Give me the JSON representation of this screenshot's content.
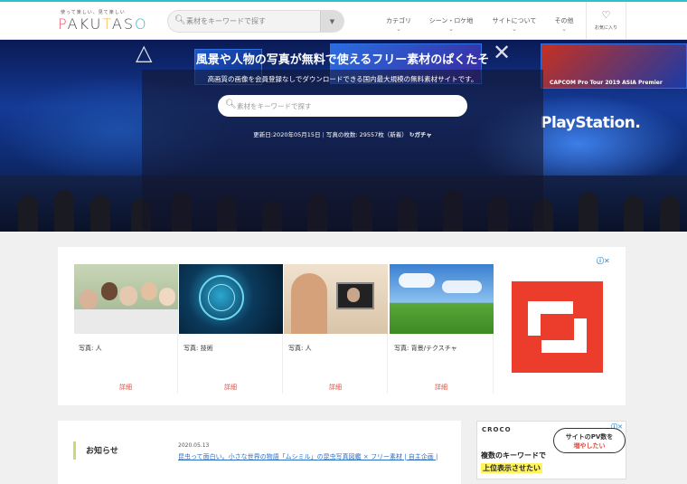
{
  "header": {
    "tagline": "使って楽しい、見て楽しい",
    "logo": "PAKUTASO",
    "search_placeholder": "素材をキーワードで探す",
    "nav": [
      {
        "label": "カテゴリ"
      },
      {
        "label": "シーン・ロケ地"
      },
      {
        "label": "サイトについて"
      },
      {
        "label": "その他"
      }
    ],
    "favorites_label": "お気に入り"
  },
  "hero": {
    "title": "風景や人物の写真が無料で使えるフリー素材のぱくたそ",
    "subtitle": "高画質の画像を会員登録なしでダウンロードできる国内最大規模の無料素材サイトです。",
    "search_placeholder": "素材をキーワードで探す",
    "updated": "更新日:2020年05月15日",
    "photo_count": "写真の枚数: 29557枚（新着）",
    "gacha": "ガチャ",
    "bg_text_playstation": "PlayStation.",
    "bg_text_capcom": "CAPCOM Pro Tour 2019 ASIA Premier"
  },
  "ad_cards": [
    {
      "caption": "写真: 人",
      "detail": "詳細"
    },
    {
      "caption": "写真: 技術",
      "detail": "詳細"
    },
    {
      "caption": "写真: 人",
      "detail": "詳細"
    },
    {
      "caption": "写真: 背景/テクスチャ",
      "detail": "詳細"
    }
  ],
  "news": {
    "heading": "お知らせ",
    "date": "2020.05.13",
    "link": "昆虫って面白い。小さな世界の物語「ムシミル」の昆虫写真図鑑 × フリー素材 | 自主企画 |"
  },
  "ad2": {
    "brand": "CROCO",
    "bubble_line1": "サイトのPV数を",
    "bubble_line2": "増やしたい",
    "line1": "複数のキーワードで",
    "line2": "上位表示させたい"
  },
  "colors": {
    "accent": "#2fc0c8",
    "red": "#e94a3c",
    "link": "#2c6fc7"
  }
}
